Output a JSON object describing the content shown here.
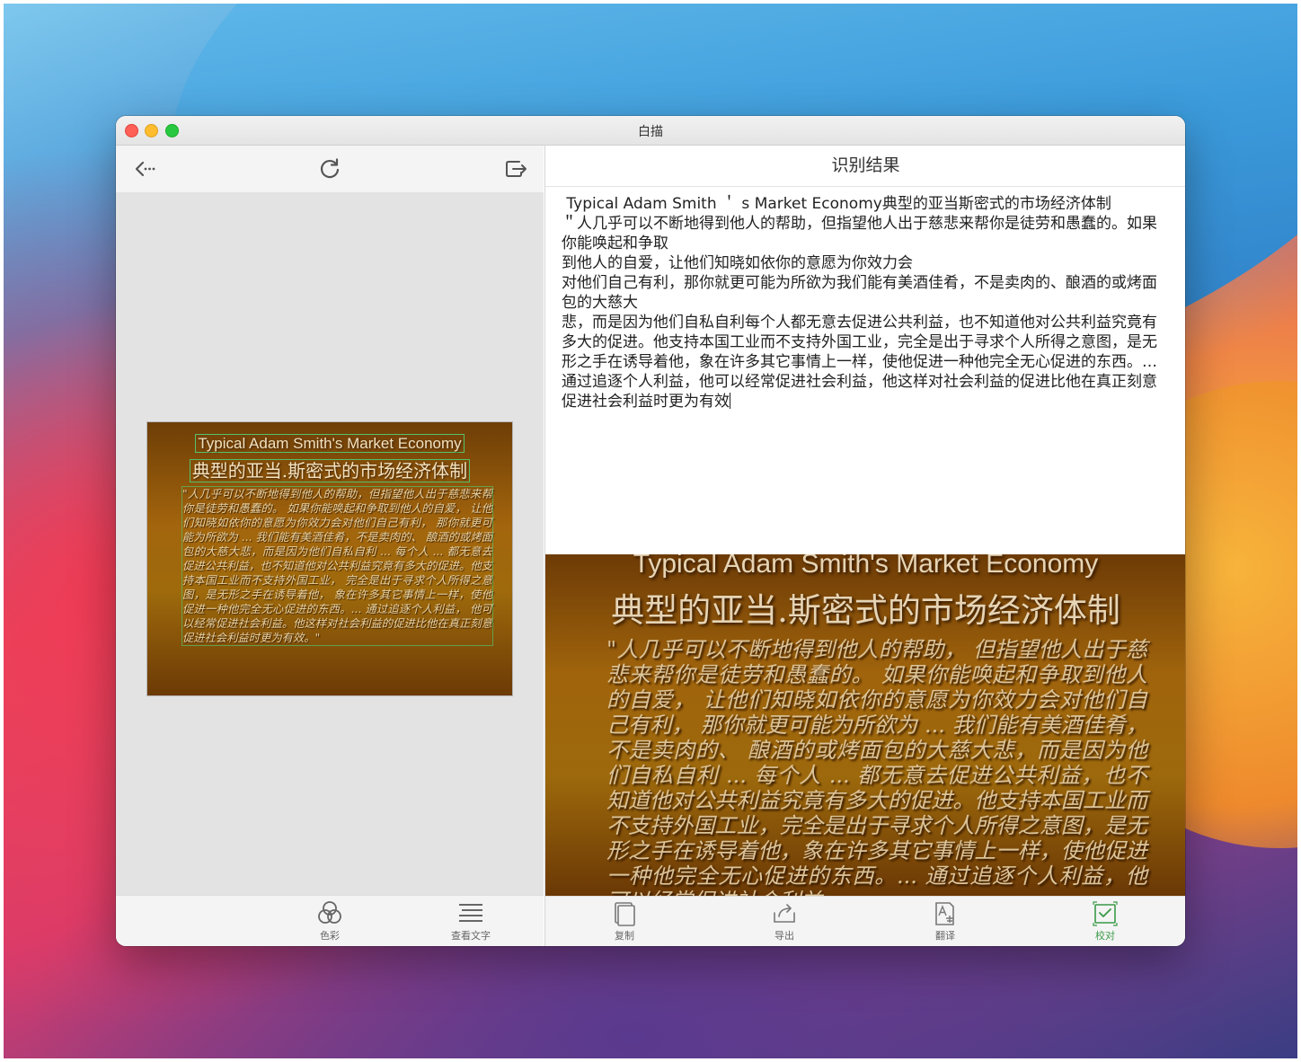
{
  "window": {
    "title": "白描"
  },
  "left_toolbar": {
    "back_icon": "back-arrow-icon",
    "refresh_icon": "refresh-icon",
    "share_icon": "share-icon"
  },
  "thumbnail": {
    "title_en": "Typical Adam Smith's Market Economy",
    "title_cn": "典型的亚当.斯密式的市场经济体制",
    "body": "\"人几乎可以不断地得到他人的帮助，但指望他人出于慈悲来帮你是徒劳和愚蠢的。 如果你能唤起和争取到他人的自爱， 让他们知晓如依你的意愿为你效力会对他们自己有利， 那你就更可能为所欲为 ... 我们能有美酒佳肴，不是卖肉的、 酿酒的或烤面包的大慈大悲，而是因为他们自私自利 ... 每个人 ... 都无意去促进公共利益，也不知道他对公共利益究竟有多大的促进。他支持本国工业而不支持外国工业， 完全是出于寻求个人所得之意图，是无形之手在诱导着他， 象在许多其它事情上一样，使他促进一种他完全无心促进的东西。... 通过追逐个人利益， 他可以经常促进社会利益。他这样对社会利益的促进比他在真正刻意促进社会利益时更为有效。\""
  },
  "left_bottom": [
    {
      "label": "色彩",
      "icon": "color-circles-icon"
    },
    {
      "label": "查看文字",
      "icon": "text-lines-icon"
    }
  ],
  "right_header": {
    "title": "识别结果"
  },
  "result_text": " Typical Adam Smith ＇ s Market Economy典型的亚当斯密式的市场经济体制\n＂人几乎可以不断地得到他人的帮助，但指望他人出于慈悲来帮你是徒劳和愚蠢的。如果你能唤起和争取\n到他人的自爱，让他们知晓如依你的意愿为你效力会\n对他们自己有利，那你就更可能为所欲为我们能有美酒佳肴，不是卖肉的、酿酒的或烤面包的大慈大\n悲，而是因为他们自私自利每个人都无意去促进公共利益，也不知道他对公共利益究竟有多大的促进。他支持本国工业而不支持外国工业，完全是出于寻求个人所得之意图，是无形之手在诱导着他，象在许多其它事情上一样，使他促进一种他完全无心促进的东西。…通过追逐个人利益，他可以经常促进社会利益，他这样对社会利益的促进比他在真正刻意促进社会利益时更为有效",
  "preview": {
    "title_en": "Typical Adam Smith's Market Economy",
    "title_cn": "典型的亚当.斯密式的市场经济体制",
    "body": "\"人几乎可以不断地得到他人的帮助， 但指望他人出于慈悲来帮你是徒劳和愚蠢的。 如果你能唤起和争取到他人的自爱， 让他们知晓如依你的意愿为你效力会对他们自己有利， 那你就更可能为所欲为 ... 我们能有美酒佳肴，不是卖肉的、 酿酒的或烤面包的大慈大悲，而是因为他们自私自利 ... 每个人 ... 都无意去促进公共利益，也不知道他对公共利益究竟有多大的促进。他支持本国工业而不支持外国工业，完全是出于寻求个人所得之意图，是无形之手在诱导着他，象在许多其它事情上一样，使他促进一种他完全无心促进的东西。... 通过追逐个人利益，他可以经常促进社会利益。"
  },
  "right_bottom": [
    {
      "label": "复制",
      "icon": "copy-icon"
    },
    {
      "label": "导出",
      "icon": "export-icon"
    },
    {
      "label": "翻译",
      "icon": "translate-icon"
    },
    {
      "label": "校对",
      "icon": "proofread-icon"
    }
  ],
  "colors": {
    "accent_green": "#3a9a46",
    "image_brown": "#9e640c"
  }
}
